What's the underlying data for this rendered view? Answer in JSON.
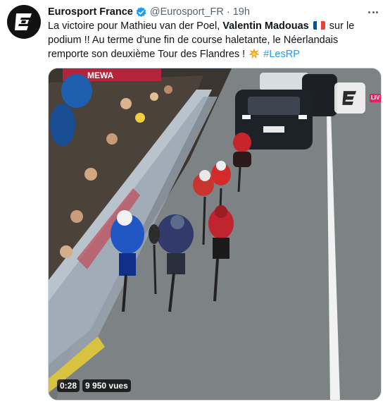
{
  "account": {
    "name": "Eurosport France",
    "handle": "@Eurosport_FR",
    "separator": "·",
    "time": "19h"
  },
  "tweet": {
    "text_part1": "La victoire pour Mathieu van der Poel, ",
    "text_bold": "Valentin Madouas",
    "text_part2": " sur le podium !! Au terme d'une fin de course haletante, le Néerlandais remporte son deuxième Tour des Flandres ! ",
    "hashtag": "#LesRP",
    "flag_emoji": "french-flag",
    "boom_emoji": "collision-emoji"
  },
  "video": {
    "duration": "0:28",
    "views": "9 950 vues",
    "live_badge": "LIV",
    "banner_text": "MEWA"
  },
  "colors": {
    "link": "#1d9bf0",
    "secondary_text": "#536471",
    "verified": "#1d9bf0",
    "border": "#cfd9de"
  }
}
